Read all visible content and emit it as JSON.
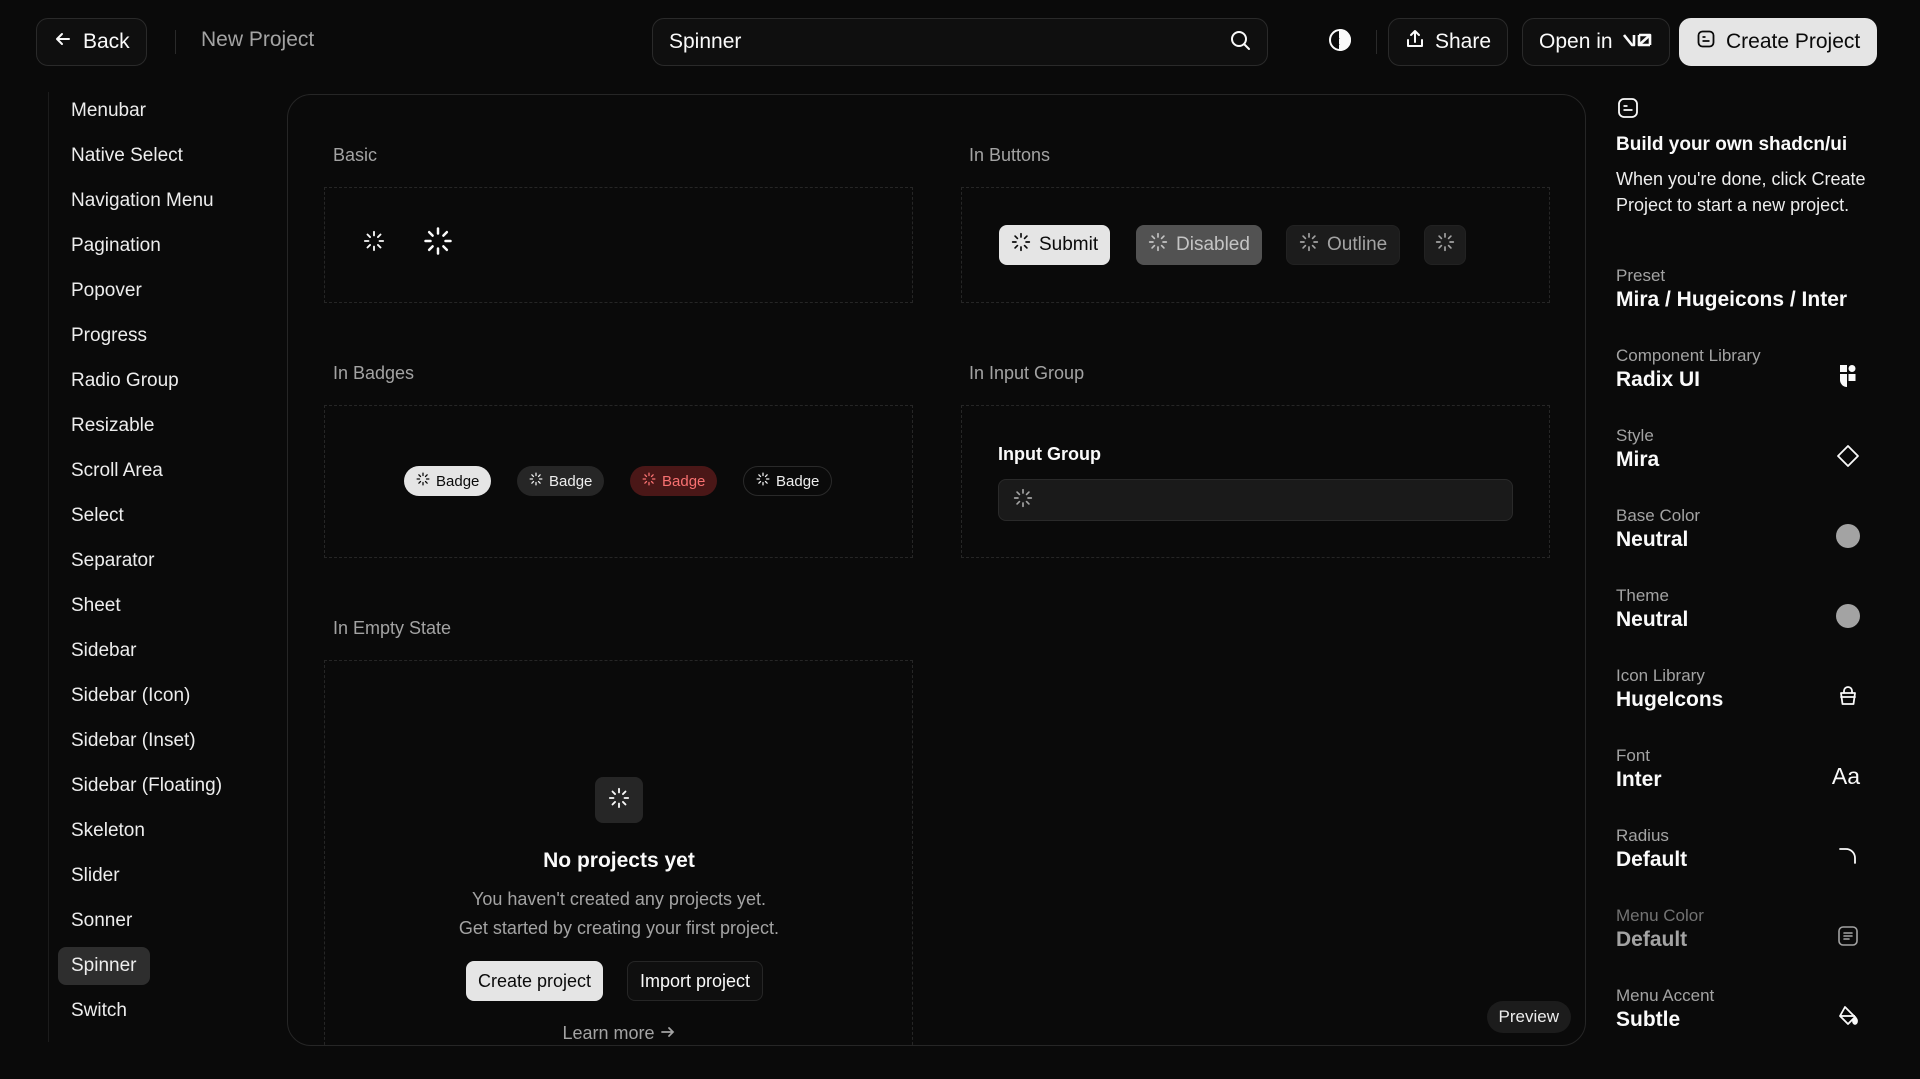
{
  "colors": {
    "background": "#0a0a0a",
    "surface": "#0f0f0f",
    "border": "#2a2a2a",
    "text": "#fafafa",
    "muted": "#a3a3a3",
    "primary": "#e5e5e5",
    "destructive_bg": "#4a1717",
    "destructive_text": "#f87171"
  },
  "header": {
    "back_label": "Back",
    "project_title": "New Project",
    "search_value": "Spinner",
    "search_icon": "search-icon",
    "theme_icon": "contrast-icon",
    "share_label": "Share",
    "open_in_label": "Open in",
    "create_project_label": "Create Project"
  },
  "sidebar": {
    "items": [
      "Menubar",
      "Native Select",
      "Navigation Menu",
      "Pagination",
      "Popover",
      "Progress",
      "Radio Group",
      "Resizable",
      "Scroll Area",
      "Select",
      "Separator",
      "Sheet",
      "Sidebar",
      "Sidebar (Icon)",
      "Sidebar (Inset)",
      "Sidebar (Floating)",
      "Skeleton",
      "Slider",
      "Sonner",
      "Spinner",
      "Switch"
    ],
    "active": "Spinner"
  },
  "main": {
    "basic": {
      "title": "Basic"
    },
    "in_buttons": {
      "title": "In Buttons",
      "submit": "Submit",
      "disabled": "Disabled",
      "outline": "Outline"
    },
    "in_badges": {
      "title": "In Badges",
      "badges": [
        "Badge",
        "Badge",
        "Badge",
        "Badge"
      ]
    },
    "in_input_group": {
      "title": "In Input Group",
      "label": "Input Group"
    },
    "in_empty_state": {
      "title": "In Empty State",
      "heading": "No projects yet",
      "line1": "You haven't created any projects yet.",
      "line2": "Get started by creating your first project.",
      "create_label": "Create project",
      "import_label": "Import project",
      "learn_more": "Learn more"
    },
    "preview_label": "Preview"
  },
  "right_panel": {
    "build_title": "Build your own shadcn/ui",
    "build_desc": "When you're done, click Create Project to start a new project.",
    "options": [
      {
        "label": "Preset",
        "value": "Mira / Hugeicons / Inter",
        "icon": ""
      },
      {
        "label": "Component Library",
        "value": "Radix UI",
        "icon": "radix-icon"
      },
      {
        "label": "Style",
        "value": "Mira",
        "icon": "diamond-icon"
      },
      {
        "label": "Base Color",
        "value": "Neutral",
        "icon": "color-dot-icon"
      },
      {
        "label": "Theme",
        "value": "Neutral",
        "icon": "color-dot-icon"
      },
      {
        "label": "Icon Library",
        "value": "HugeIcons",
        "icon": "hugeicons-icon"
      },
      {
        "label": "Font",
        "value": "Inter",
        "icon": "font-icon"
      },
      {
        "label": "Radius",
        "value": "Default",
        "icon": "radius-icon"
      },
      {
        "label": "Menu Color",
        "value": "Default",
        "icon": "menu-icon"
      },
      {
        "label": "Menu Accent",
        "value": "Subtle",
        "icon": "paint-bucket-icon"
      }
    ],
    "font_icon_text": "Aa"
  }
}
